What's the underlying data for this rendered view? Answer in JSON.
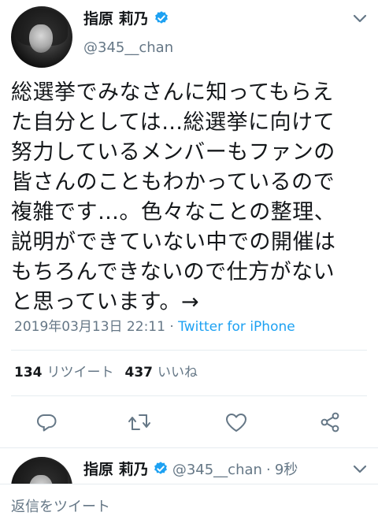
{
  "tweet": {
    "author_name": "指原 莉乃",
    "author_handle": "@345__chan",
    "text": "総選挙でみなさんに知ってもらえ\nた自分としては…総選挙に向けて\n努力しているメンバーもファンの\n皆さんのこともわかっているので\n複雑です…。色々なことの整理、\n説明ができていない中での開催は\nもちろんできないので仕方がない\nと思っています。→",
    "timestamp": "2019年03月13日 22:11",
    "separator": "·",
    "source": "Twitter for iPhone",
    "retweet_count": "134",
    "retweet_label": "リツイート",
    "like_count": "437",
    "like_label": "いいね"
  },
  "reply_tweet": {
    "author_name": "指原 莉乃",
    "author_handle": "@345__chan",
    "separator": "·",
    "time_ago": "9秒"
  },
  "reply_bar": {
    "placeholder": "返信をツイート"
  },
  "icons": {
    "verified": "verified-badge-icon",
    "chevron": "chevron-down-icon",
    "reply": "reply-icon",
    "retweet": "retweet-icon",
    "like": "heart-icon",
    "share": "share-icon"
  },
  "colors": {
    "accent": "#1da1f2",
    "secondary_text": "#657786",
    "icon_gray": "#657786",
    "divider": "#e6ecf0"
  }
}
